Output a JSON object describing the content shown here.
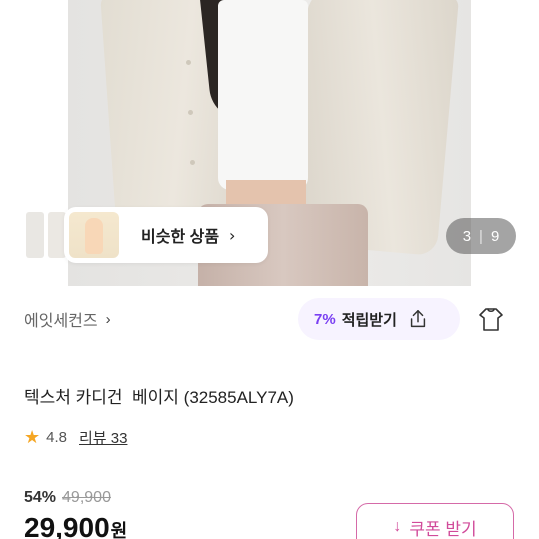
{
  "hero": {
    "similar_label": "비슷한 상품",
    "pager_current": "3",
    "pager_sep": "|",
    "pager_total": "9"
  },
  "brand": {
    "name": "에잇세컨즈"
  },
  "reward": {
    "percent": "7%",
    "label": "적립받기"
  },
  "product": {
    "title": "텍스처 카디건  베이지 (32585ALY7A)",
    "rating": "4.8",
    "review_label": "리뷰 33"
  },
  "price": {
    "discount": "54%",
    "original": "49,900",
    "current": "29,900",
    "currency": "원"
  },
  "coupon": {
    "label": "쿠폰 받기"
  },
  "icons": [
    "chevron-right-icon",
    "share-icon",
    "hanger-icon",
    "star-icon",
    "download-arrow-icon"
  ],
  "colors": {
    "accent_purple": "#7a3ff2",
    "coupon_pink": "#d14b9a",
    "star": "#f5a623"
  }
}
